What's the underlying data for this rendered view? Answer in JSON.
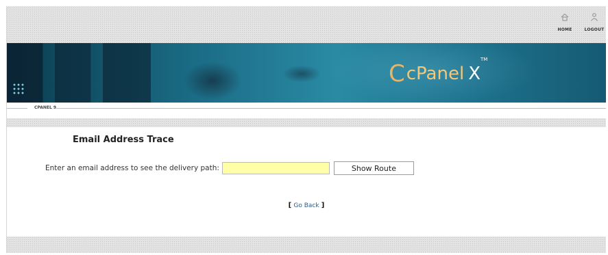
{
  "topnav": {
    "home_label": "HOME",
    "logout_label": "LOGOUT"
  },
  "banner": {
    "logo_mark": "C",
    "logo_name": "cPanel",
    "logo_x": "X",
    "logo_tm": "TM"
  },
  "breadcrumb": {
    "label": "CPANEL 9"
  },
  "main": {
    "title": "Email Address Trace",
    "prompt": "Enter an email address to see the delivery path:",
    "email_value": "",
    "show_route_label": "Show Route",
    "go_back_open": "[",
    "go_back_label": "Go Back",
    "go_back_close": "]"
  },
  "colors": {
    "input_bg": "#ffffa8",
    "link": "#2a5a86",
    "logo": "#f3c87a"
  }
}
